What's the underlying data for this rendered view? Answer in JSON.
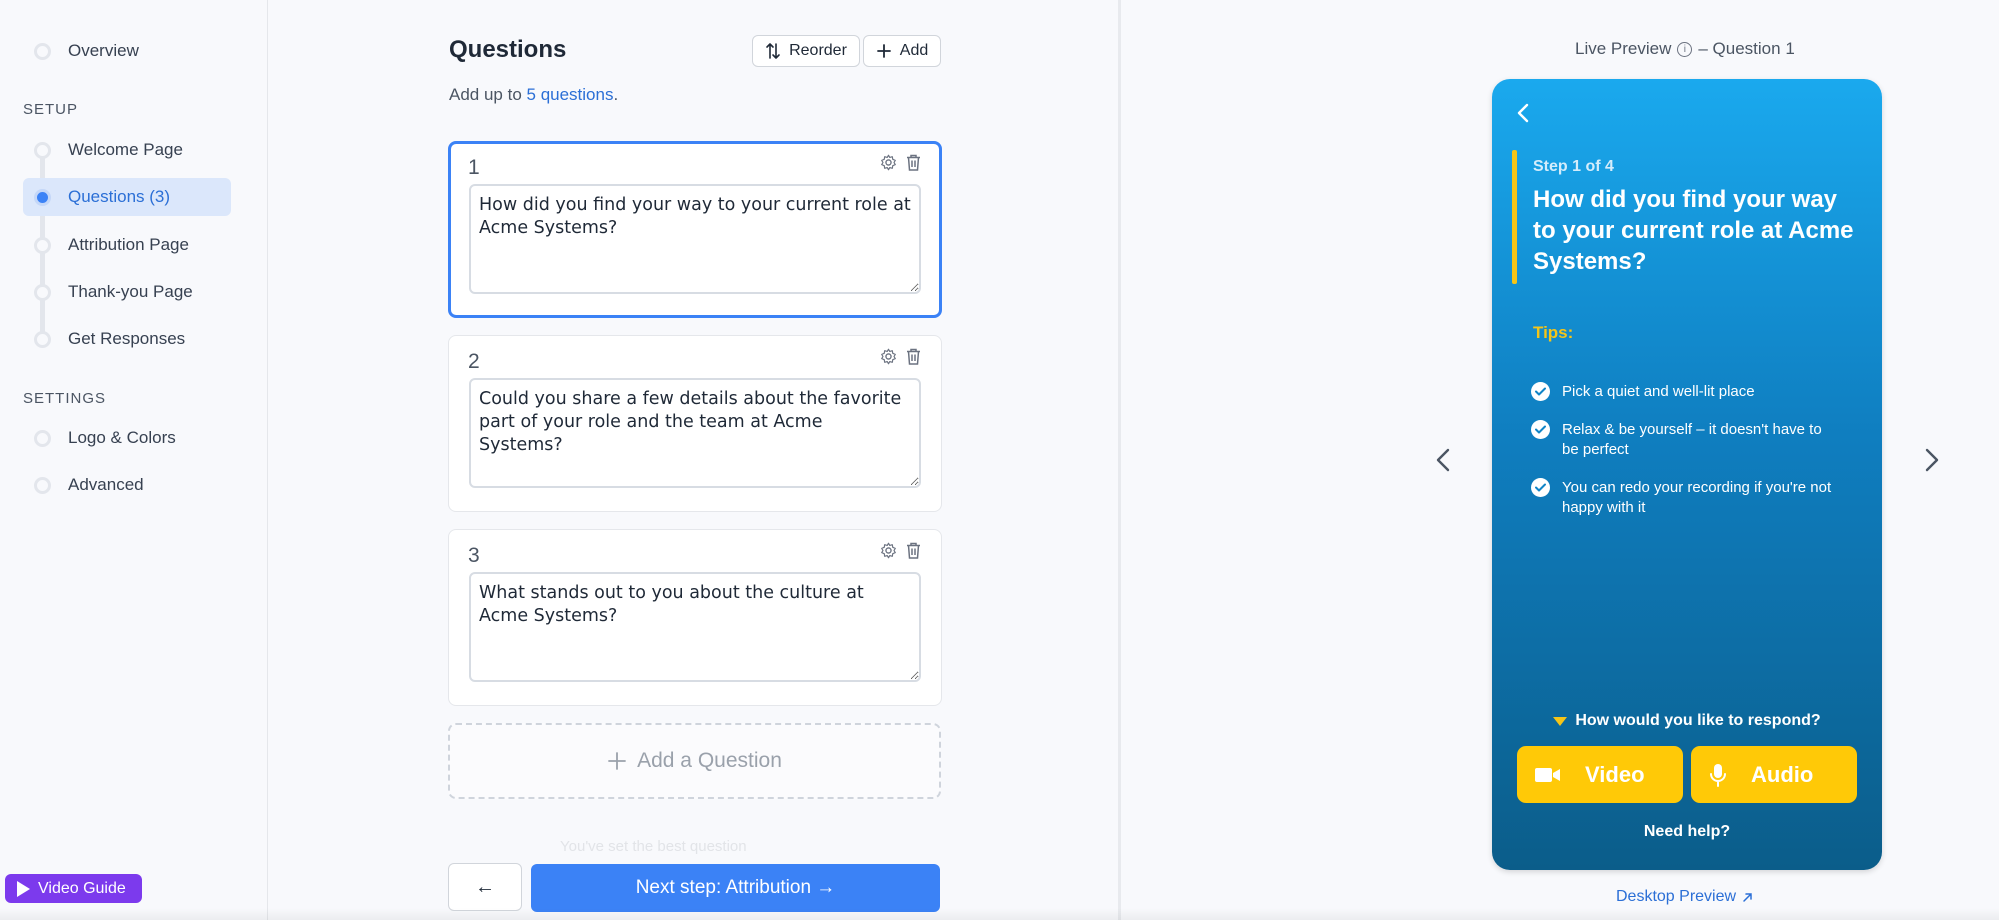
{
  "sidebar": {
    "overview": "Overview",
    "setup_label": "SETUP",
    "setup_items": [
      {
        "label": "Welcome Page"
      },
      {
        "label": "Questions (3)"
      },
      {
        "label": "Attribution Page"
      },
      {
        "label": "Thank-you Page"
      },
      {
        "label": "Get Responses"
      }
    ],
    "settings_label": "SETTINGS",
    "settings_items": [
      {
        "label": "Logo & Colors"
      },
      {
        "label": "Advanced"
      }
    ],
    "video_guide": "Video Guide"
  },
  "editor": {
    "title": "Questions",
    "reorder_label": "Reorder",
    "add_label": "Add",
    "subtitle_prefix": "Add up to ",
    "subtitle_link": "5 questions",
    "subtitle_suffix": ".",
    "questions": [
      {
        "number": "1",
        "text": "How did you find your way to your current role at Acme Systems?"
      },
      {
        "number": "2",
        "text": "Could you share a few details about the favorite part of your role and the team at Acme Systems?"
      },
      {
        "number": "3",
        "text": "What stands out to you about the culture at Acme Systems?"
      }
    ],
    "add_question_label": "Add a Question",
    "faded_hint": "You've set the best question",
    "back_arrow": "←",
    "next_label": "Next step: Attribution →"
  },
  "preview": {
    "label": "Live Preview",
    "info_glyph": "i",
    "question_ref": "– Question 1",
    "step_label": "Step 1 of 4",
    "question": "How did you find your way to your current role at Acme Systems?",
    "tips_label": "Tips:",
    "tips": [
      {
        "text": "Pick a quiet and well-lit place"
      },
      {
        "text": "Relax & be yourself – it doesn't have to be perfect"
      },
      {
        "text": "You can redo your recording if you're not happy with it"
      }
    ],
    "respond_label": "How would you like to respond?",
    "video_label": "Video",
    "audio_label": "Audio",
    "need_help": "Need help?",
    "desktop_preview": "Desktop Preview",
    "icons": {
      "prev": "chevron-left-icon",
      "next": "chevron-right-icon",
      "external": "external-link-icon"
    }
  },
  "colors": {
    "accent": "#3b82f6",
    "accent_text": "#2b6fd6",
    "phone_top": "#1aa9ee",
    "phone_bottom": "#0b5d8a",
    "yellow": "#ffc907",
    "video_guide": "#7c3aed"
  }
}
